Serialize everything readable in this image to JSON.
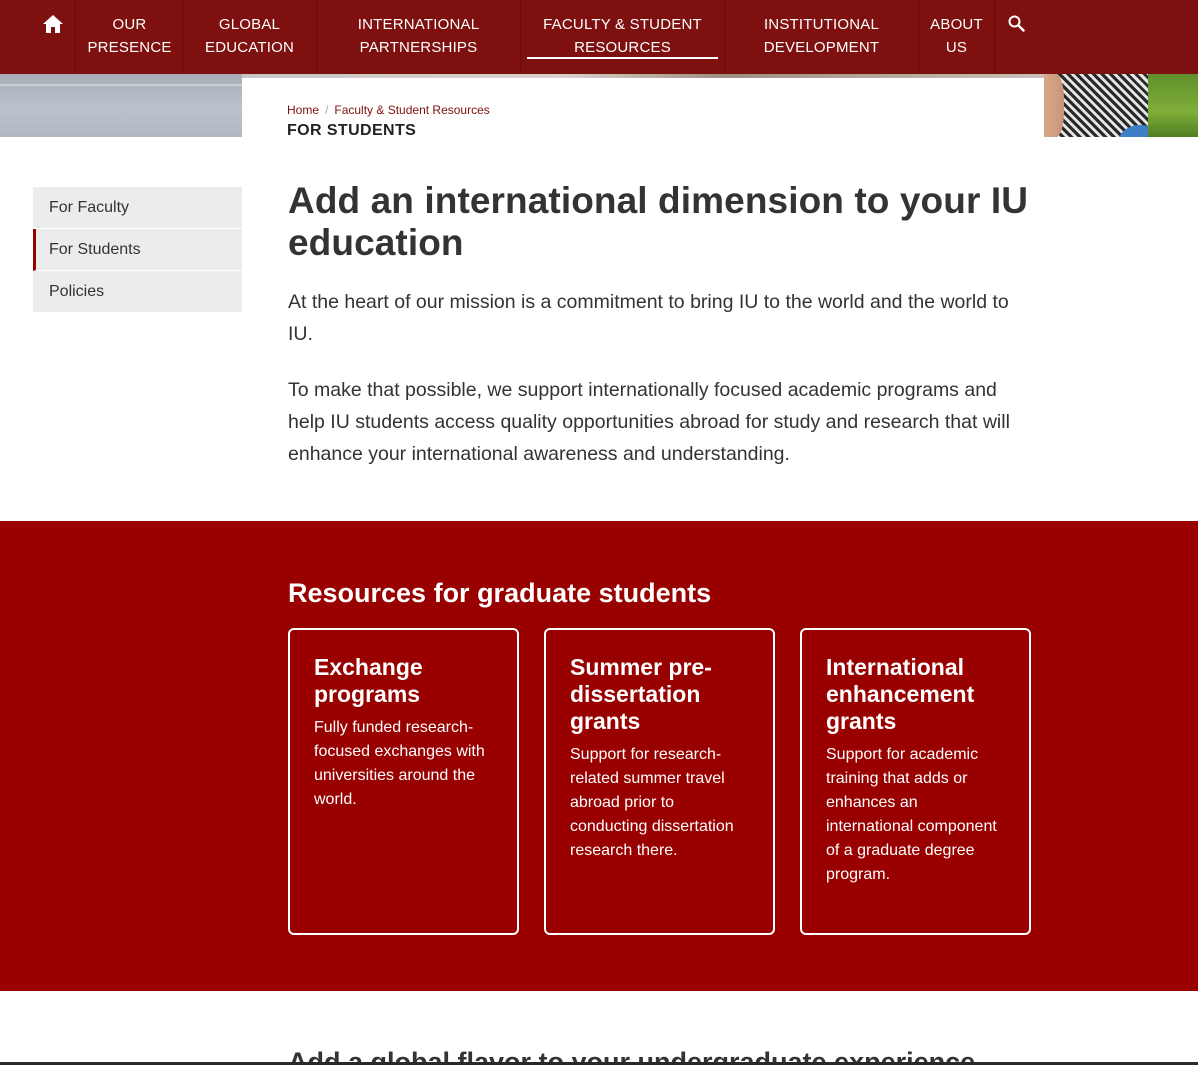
{
  "nav": {
    "items": [
      {
        "line1": "OUR",
        "line2": "PRESENCE"
      },
      {
        "line1": "GLOBAL",
        "line2": "EDUCATION"
      },
      {
        "line1": "INTERNATIONAL",
        "line2": "PARTNERSHIPS"
      },
      {
        "line1": "FACULTY & STUDENT",
        "line2": "RESOURCES"
      },
      {
        "line1": "INSTITUTIONAL",
        "line2": "DEVELOPMENT"
      },
      {
        "line1": "ABOUT",
        "line2": "US"
      }
    ],
    "active_index": 3,
    "home_icon": "home-icon",
    "search_icon": "search-icon"
  },
  "breadcrumb": {
    "home": "Home",
    "separator": "/",
    "section": "Faculty & Student Resources"
  },
  "page_label": "FOR STUDENTS",
  "sidenav": {
    "items": [
      {
        "label": "For Faculty"
      },
      {
        "label": "For Students"
      },
      {
        "label": "Policies"
      }
    ],
    "active_index": 1
  },
  "main": {
    "title": "Add an international dimension to your IU education",
    "para1": "At the heart of our mission is a commitment to bring IU to the world and the world to IU.",
    "para2": "To make that possible, we support internationally focused academic programs and help IU students access quality opportunities abroad for study and research that will enhance your international awareness and understanding."
  },
  "resources": {
    "heading": "Resources for graduate students",
    "cards": [
      {
        "title": "Exchange programs",
        "desc": "Fully funded research-focused exchanges with universities around the world."
      },
      {
        "title": "Summer pre-dissertation grants",
        "desc": "Support for research-related summer travel abroad prior to conducting dissertation research there."
      },
      {
        "title": "International enhancement grants",
        "desc": "Support for academic training that adds or enhances an international component of a graduate degree program."
      }
    ]
  },
  "next_section": {
    "heading": "Add a global flavor to your undergraduate experience"
  },
  "colors": {
    "nav_bg": "#7f1010",
    "crimson": "#990000",
    "text": "#333333",
    "sidenav_bg": "#ececec"
  }
}
